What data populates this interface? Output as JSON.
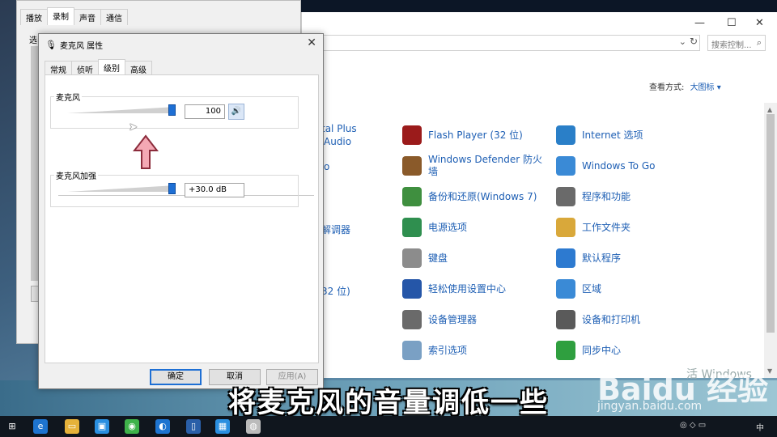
{
  "sound_window": {
    "tabs": [
      "播放",
      "录制",
      "声音",
      "通信"
    ],
    "active_tab": 1,
    "fragment_label": "选"
  },
  "properties_dialog": {
    "title": "麦克风 属性",
    "tabs": [
      "常规",
      "侦听",
      "级别",
      "高级"
    ],
    "active_tab": 2,
    "microphone": {
      "label": "麦克风",
      "value": "100",
      "level_fraction": 1.0
    },
    "boost": {
      "label": "麦克风加强",
      "value": "+30.0 dB",
      "level_fraction": 1.0
    },
    "buttons": {
      "ok": "确定",
      "cancel": "取消",
      "apply": "应用(A)"
    }
  },
  "control_panel": {
    "search_placeholder": "搜索控制...",
    "view_label": "查看方式:",
    "view_value": "大图标",
    "left_fragments": [
      "tal Plus",
      "Audio",
      "o",
      "解调器",
      "32 位)"
    ],
    "items": [
      {
        "label": "Flash Player (32 位)",
        "icon": "flash-icon",
        "color": "#9b1b1b"
      },
      {
        "label": "Internet 选项",
        "icon": "globe-icon",
        "color": "#2a7fc8"
      },
      {
        "label": "Windows Defender 防火墙",
        "icon": "firewall-icon",
        "color": "#8a5a2a"
      },
      {
        "label": "Windows To Go",
        "icon": "windows-to-go-icon",
        "color": "#3a8ad6"
      },
      {
        "label": "备份和还原(Windows 7)",
        "icon": "backup-icon",
        "color": "#3f8f3f"
      },
      {
        "label": "程序和功能",
        "icon": "programs-icon",
        "color": "#6a6a6a"
      },
      {
        "label": "电源选项",
        "icon": "power-icon",
        "color": "#2f8f4f"
      },
      {
        "label": "工作文件夹",
        "icon": "work-folder-icon",
        "color": "#d9a83a"
      },
      {
        "label": "键盘",
        "icon": "keyboard-icon",
        "color": "#8c8c8c"
      },
      {
        "label": "默认程序",
        "icon": "default-programs-icon",
        "color": "#2d7ad0"
      },
      {
        "label": "轻松使用设置中心",
        "icon": "ease-of-access-icon",
        "color": "#2556a8"
      },
      {
        "label": "区域",
        "icon": "region-icon",
        "color": "#3a8ad6"
      },
      {
        "label": "设备管理器",
        "icon": "device-manager-icon",
        "color": "#6a6a6a"
      },
      {
        "label": "设备和打印机",
        "icon": "printer-icon",
        "color": "#5a5a5a"
      },
      {
        "label": "索引选项",
        "icon": "indexing-icon",
        "color": "#7aa0c4"
      },
      {
        "label": "同步中心",
        "icon": "sync-icon",
        "color": "#2f9f3f"
      }
    ]
  },
  "caption": "将麦克风的音量调低一些",
  "watermark": {
    "activate": "活 Windows",
    "brand": "Baidu 经验",
    "site": "jingyan.baidu.com"
  },
  "taskbar": {
    "ime": "中"
  }
}
